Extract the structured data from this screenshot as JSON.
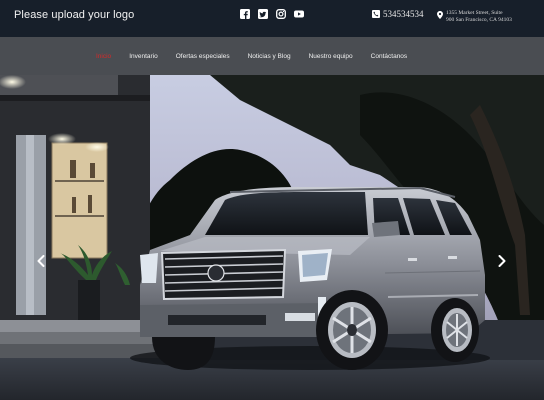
{
  "header": {
    "logo_text": "Please upload your logo",
    "social_icons": [
      "facebook-icon",
      "twitter-icon",
      "instagram-icon",
      "youtube-icon"
    ],
    "phone": "534534534",
    "address_line1": "1355 Market Street, Suite",
    "address_line2": "900 San Francisco, CA 94103"
  },
  "nav": {
    "items": [
      {
        "label": "Inicio",
        "active": true
      },
      {
        "label": "Inventario",
        "active": false
      },
      {
        "label": "Ofertas especiales",
        "active": false
      },
      {
        "label": "Noticias y Blog",
        "active": false
      },
      {
        "label": "Nuestro equipo",
        "active": false
      },
      {
        "label": "Contáctanos",
        "active": false
      }
    ]
  },
  "colors": {
    "topbar_bg": "#171f2a",
    "navbar_bg": "#4a4d52",
    "nav_active": "#d42a2a",
    "nav_text": "#f0f0f0"
  },
  "hero": {
    "image_subject": "silver SUV parked at night in front of a building",
    "prev_icon": "chevron-left-icon",
    "next_icon": "chevron-right-icon"
  }
}
